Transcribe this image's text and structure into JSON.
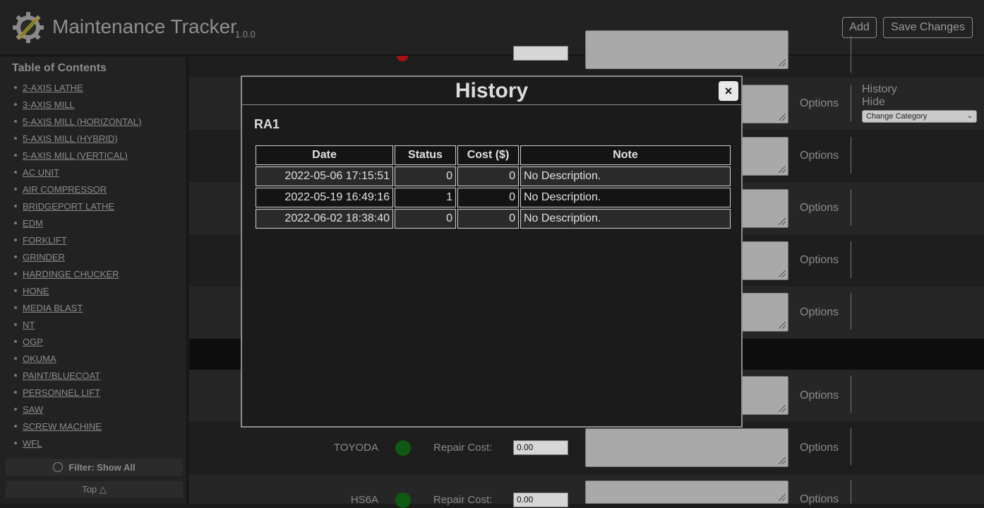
{
  "header": {
    "title": "Maintenance Tracker",
    "version": "1.0.0",
    "add_label": "Add",
    "save_label": "Save Changes"
  },
  "sidebar": {
    "toc_title": "Table of Contents",
    "items": [
      {
        "label": "2-AXIS LATHE"
      },
      {
        "label": "3-AXIS MILL"
      },
      {
        "label": "5-AXIS MILL (HORIZONTAL)"
      },
      {
        "label": "5-AXIS MILL (HYBRID)"
      },
      {
        "label": "5-AXIS MILL (VERTICAL)"
      },
      {
        "label": "AC UNIT"
      },
      {
        "label": "AIR COMPRESSOR"
      },
      {
        "label": "BRIDGEPORT LATHE"
      },
      {
        "label": "EDM"
      },
      {
        "label": "FORKLIFT"
      },
      {
        "label": "GRINDER"
      },
      {
        "label": "HARDINGE CHUCKER"
      },
      {
        "label": "HONE"
      },
      {
        "label": "MEDIA BLAST"
      },
      {
        "label": "NT"
      },
      {
        "label": "OGP"
      },
      {
        "label": "OKUMA"
      },
      {
        "label": "PAINT/BLUECOAT"
      },
      {
        "label": "PERSONNEL LIFT"
      },
      {
        "label": "SAW"
      },
      {
        "label": "SCREW MACHINE"
      },
      {
        "label": "WFL"
      }
    ],
    "filter_label": "Filter: Show All",
    "top_label": "Top △"
  },
  "main": {
    "options_label": "Options",
    "history_label": "History",
    "hide_label": "Hide",
    "category_select": "Change Category",
    "repair_cost_label": "Repair Cost:",
    "rows": [
      {
        "machine": "TOYODA",
        "repair_cost": "0.00"
      },
      {
        "machine": "HS6A",
        "repair_cost": "0.00"
      }
    ]
  },
  "modal": {
    "title": "History",
    "close_label": "×",
    "subtitle": "RA1",
    "columns": [
      "Date",
      "Status",
      "Cost ($)",
      "Note"
    ],
    "rows": [
      {
        "date": "2022-05-06 17:15:51",
        "status": "0",
        "cost": "0",
        "note": "No Description."
      },
      {
        "date": "2022-05-19 16:49:16",
        "status": "1",
        "cost": "0",
        "note": "No Description."
      },
      {
        "date": "2022-06-02 18:38:40",
        "status": "0",
        "cost": "0",
        "note": "No Description."
      }
    ]
  },
  "colors": {
    "background": "#1b1b1b",
    "status_ok": "#0f5a12",
    "status_bad": "#a51212"
  }
}
